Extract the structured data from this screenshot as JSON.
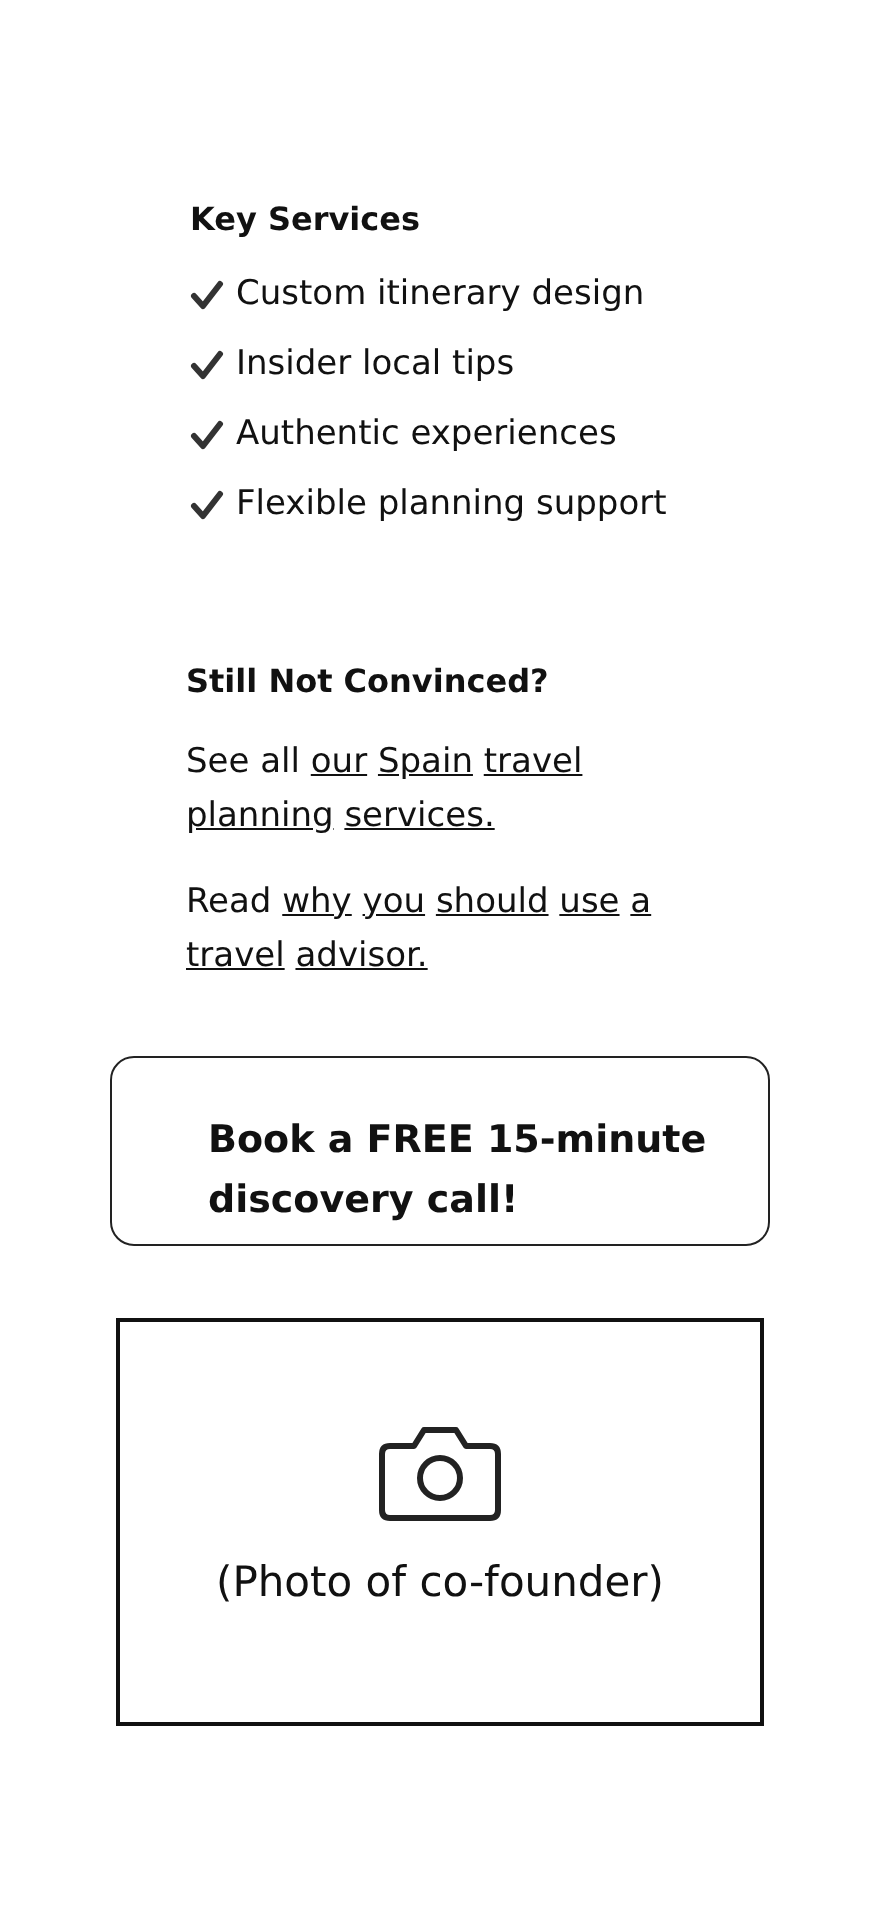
{
  "key_services": {
    "title": "Key Services",
    "items": [
      "Custom itinerary design",
      "Insider local tips",
      "Authentic experiences",
      "Flexible planning support"
    ]
  },
  "convince": {
    "title": "Still Not Convinced?",
    "paragraphs": [
      {
        "text": "See all ",
        "link": "our Spain travel planning services."
      },
      {
        "text": "Read ",
        "link": "why you should use a travel advisor."
      }
    ]
  },
  "cta_button": "Book a FREE 15-minute discovery call!",
  "photo_placeholder": {
    "caption": "(Photo of co-founder)"
  }
}
